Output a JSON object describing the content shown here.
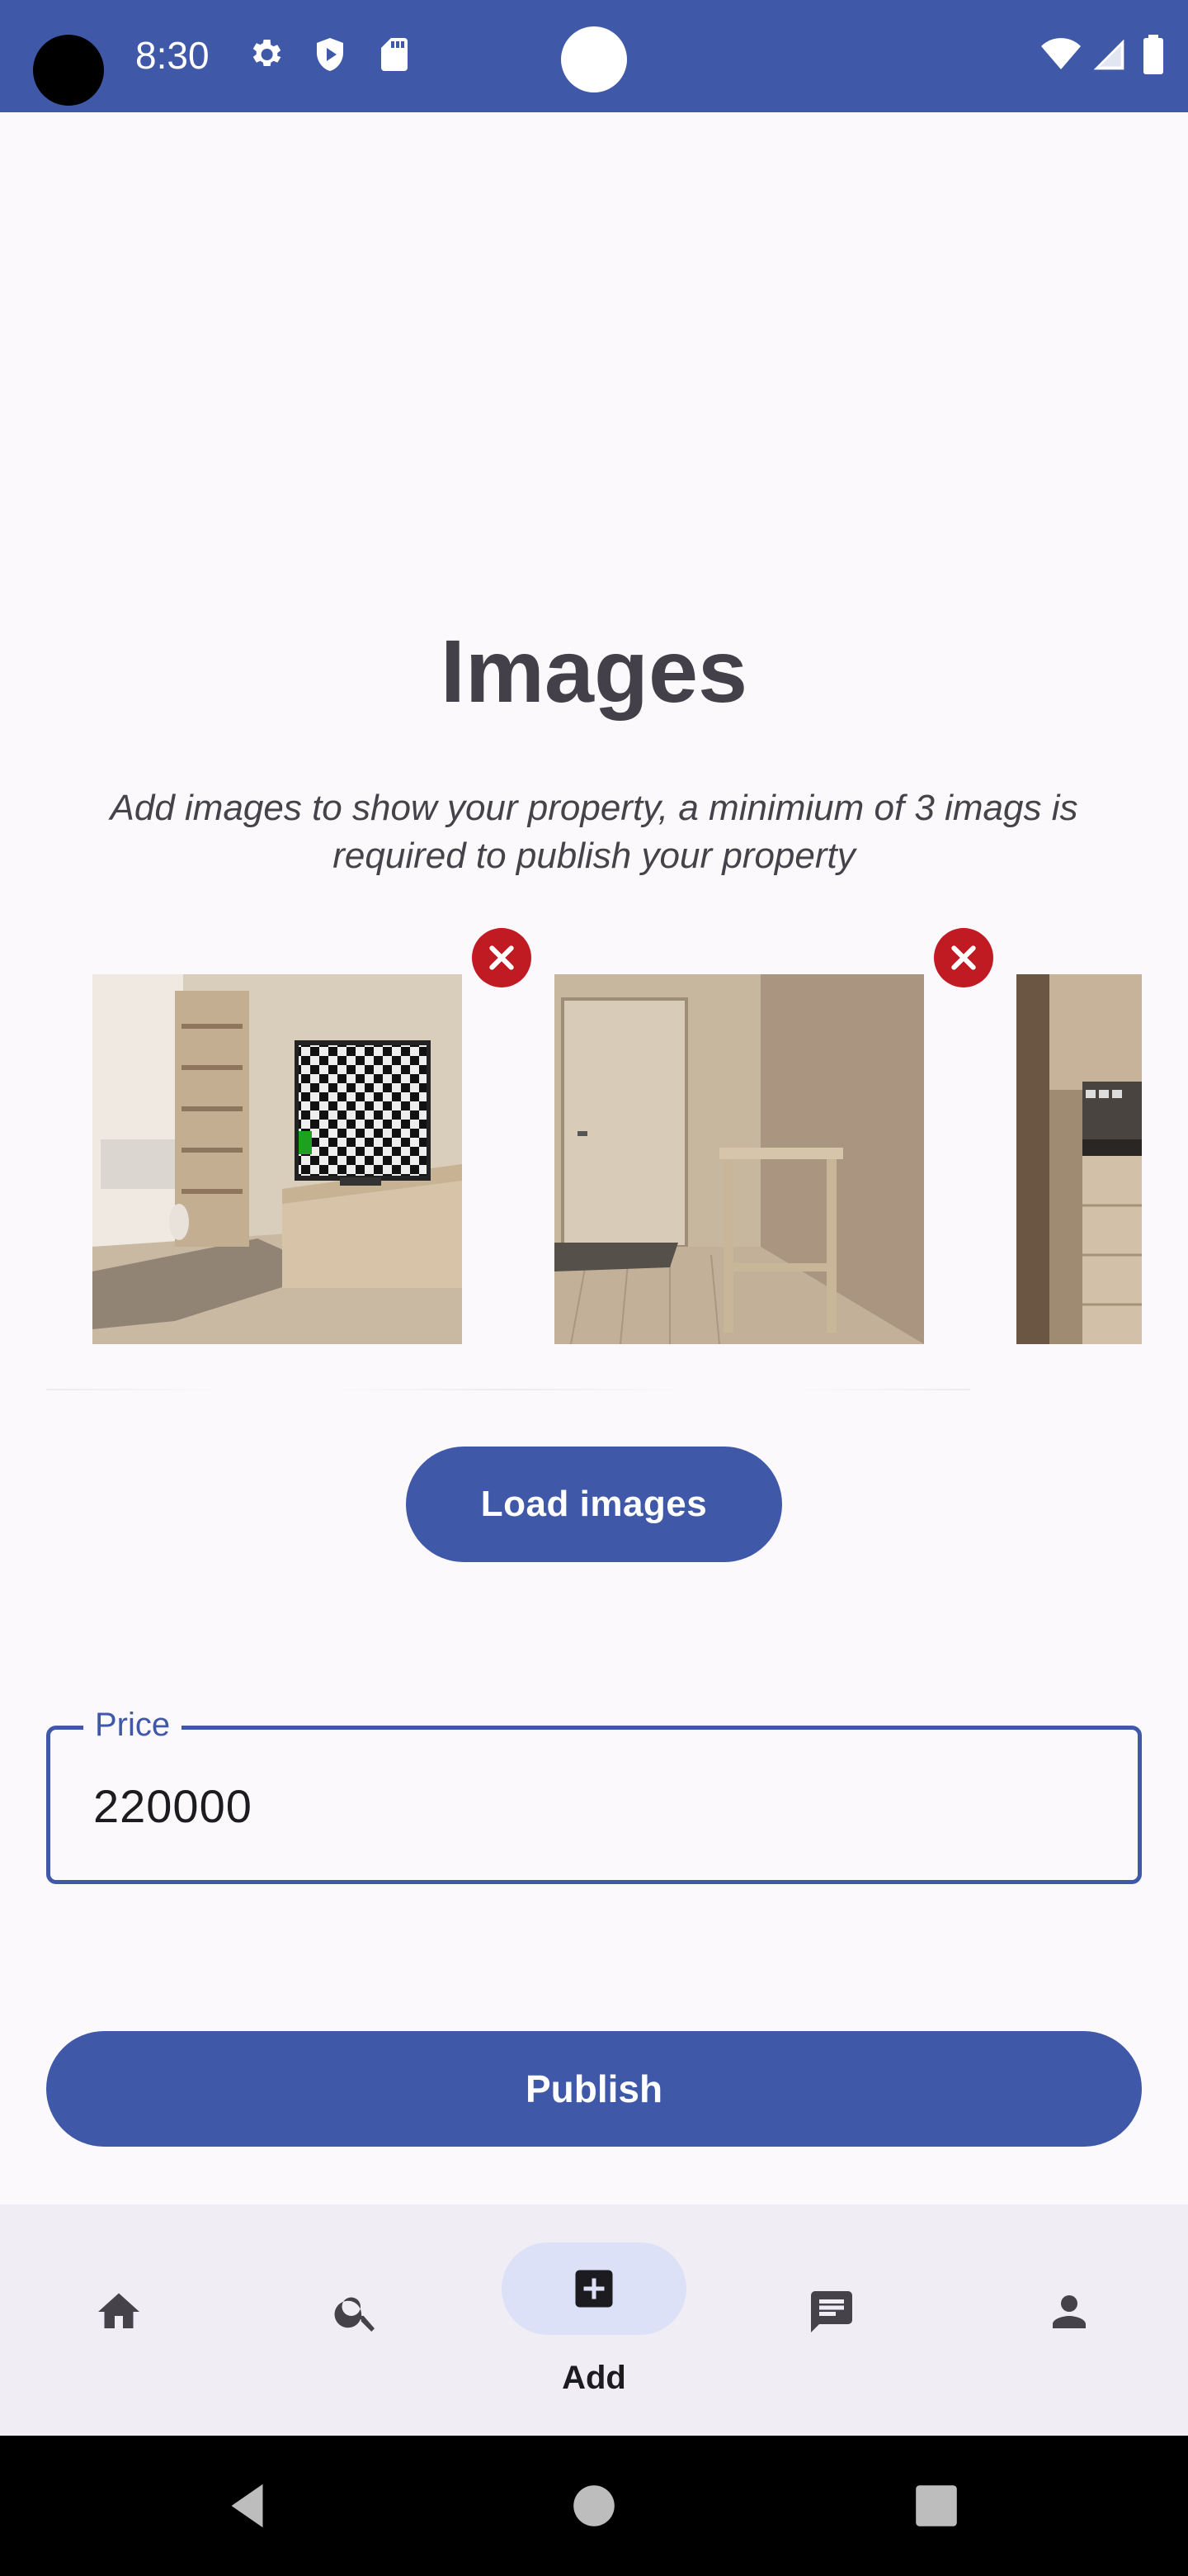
{
  "status_bar": {
    "time": "8:30",
    "icons": [
      "settings-icon",
      "shield-icon",
      "sd-card-icon",
      "wifi-icon",
      "signal-icon",
      "battery-icon"
    ]
  },
  "page": {
    "title": "Images",
    "subtitle": "Add images to show your property, a minimium of 3 imags is required to publish your property"
  },
  "gallery": {
    "images": [
      {
        "description_icon": "living-room-photo"
      },
      {
        "description_icon": "hallway-photo"
      },
      {
        "description_icon": "kitchen-photo"
      }
    ]
  },
  "load_button": {
    "label": "Load images"
  },
  "price_field": {
    "label": "Price",
    "value": "220000"
  },
  "publish_button": {
    "label": "Publish"
  },
  "bottom_nav": {
    "items": [
      {
        "icon": "home-icon",
        "label": ""
      },
      {
        "icon": "search-icon",
        "label": ""
      },
      {
        "icon": "add-icon",
        "label": "Add",
        "active": true
      },
      {
        "icon": "chat-icon",
        "label": ""
      },
      {
        "icon": "person-icon",
        "label": ""
      }
    ]
  },
  "colors": {
    "primary": "#3f59a8",
    "error": "#c01b23",
    "background": "#fcf9fc",
    "nav_background": "#f0edf5",
    "nav_pill": "#dce1f8"
  }
}
